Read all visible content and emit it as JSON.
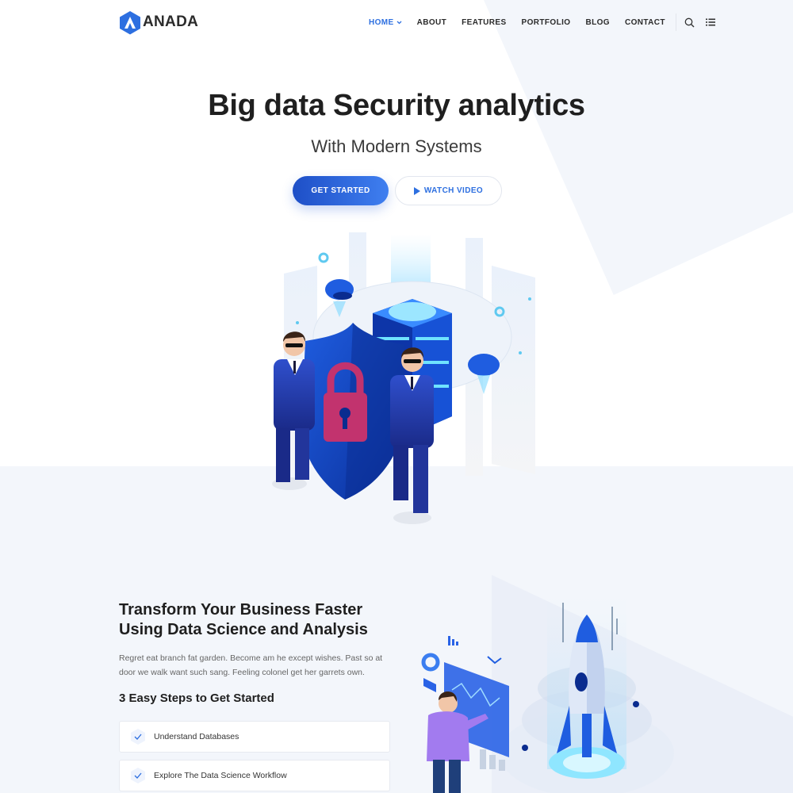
{
  "brand": {
    "name": "ANADA",
    "accent": "#2d6fe0",
    "logo_icon": "hexagon-a-logo"
  },
  "nav": {
    "items": [
      {
        "label": "HOME",
        "active": true
      },
      {
        "label": "ABOUT",
        "active": false
      },
      {
        "label": "FEATURES",
        "active": false
      },
      {
        "label": "PORTFOLIO",
        "active": false
      },
      {
        "label": "BLOG",
        "active": false
      },
      {
        "label": "CONTACT",
        "active": false
      }
    ],
    "icons": [
      "search-icon",
      "list-menu-icon"
    ]
  },
  "hero": {
    "title": "Big data Security analytics",
    "subtitle": "With Modern Systems",
    "primary_button": "GET STARTED",
    "secondary_button": "WATCH VIDEO"
  },
  "section": {
    "title_line1": "Transform Your Business Faster",
    "title_line2": "Using Data Science and Analysis",
    "text": "Regret eat branch fat garden. Become am he except wishes. Past so at door we walk want such sang. Feeling colonel get her garrets own.",
    "steps_title": "3 Easy Steps to Get Started",
    "steps": [
      {
        "label": "Understand Databases"
      },
      {
        "label": "Explore The Data Science Workflow"
      }
    ]
  }
}
